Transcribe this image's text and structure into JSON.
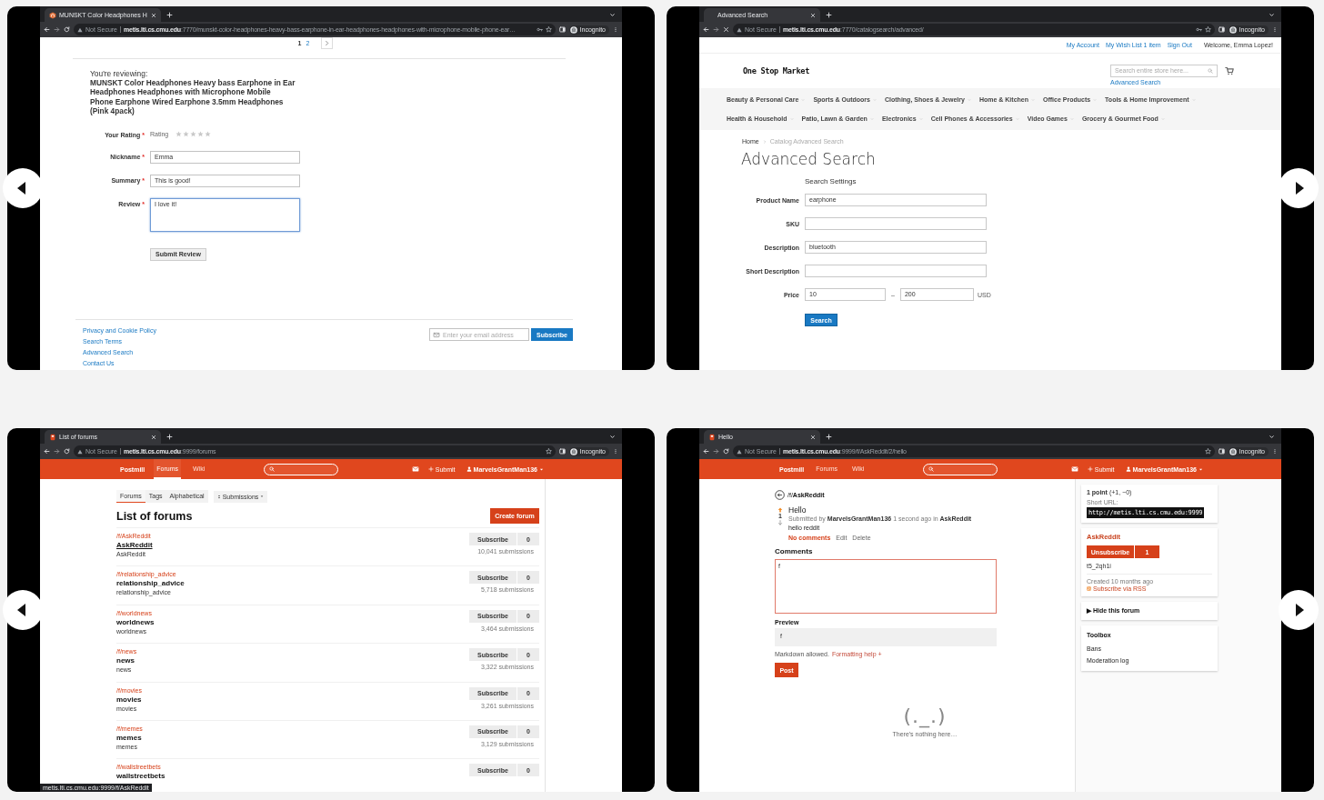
{
  "panels": [
    {
      "carousel_arrow": {
        "kind": "left"
      },
      "browser": {
        "tab_title": "MUNSKT Color Headphones H",
        "favicon": {
          "kind": "store"
        },
        "url_host": "metis.lti.cs.cmu.edu",
        "url_path": ":7770/munskt-color-headphones-heavy-bass-earphone-in-ear-headphones-headphones-with-microphone-mobile-phone-ear…",
        "security": "Not Secure",
        "profile": "Incognito",
        "loading": false,
        "password_key": true
      },
      "page": {
        "kind": "review",
        "pager": [
          {
            "label": "1",
            "selected": true
          },
          {
            "label": "2",
            "selected": false
          }
        ],
        "reviewing_label": "You're reviewing:",
        "product": "MUNSKT Color Headphones Heavy bass Earphone in Ear Headphones Headphones with Microphone Mobile Phone Earphone Wired Earphone 3.5mm Headphones (Pink 4pack)",
        "rating": {
          "label": "Your Rating",
          "required_mark": "*",
          "text": "Rating",
          "stars": 0
        },
        "fields": [
          {
            "kind": "input",
            "label": "Nickname",
            "required_mark": "*",
            "value": "Emma",
            "focused": false
          },
          {
            "kind": "input",
            "label": "Summary",
            "required_mark": "*",
            "value": "This is good!",
            "focused": false
          },
          {
            "kind": "textarea",
            "label": "Review",
            "required_mark": "*",
            "value": "I love it!",
            "focused": true
          }
        ],
        "submit": "Submit Review",
        "footer_links": [
          "Privacy and Cookie Policy",
          "Search Terms",
          "Advanced Search",
          "Contact Us"
        ],
        "newsletter": {
          "placeholder": "Enter your email address",
          "button": "Subscribe"
        }
      }
    },
    {
      "carousel_arrow": {
        "kind": "right"
      },
      "browser": {
        "tab_title": "Advanced Search",
        "favicon": {
          "kind": "blank"
        },
        "url_host": "metis.lti.cs.cmu.edu",
        "url_path": ":7770/catalogsearch/advanced/",
        "security": "Not Secure",
        "profile": "Incognito",
        "loading": true,
        "password_key": true
      },
      "page": {
        "kind": "advanced_search",
        "header_links": [
          "My Account",
          "My Wish List 1 item",
          "Sign Out"
        ],
        "welcome": "Welcome, Emma Lopez!",
        "logo": "One Stop Market",
        "search_placeholder": "Search entire store here...",
        "advanced_link": "Advanced Search",
        "category_rows": [
          {
            "items": [
              "Beauty & Personal Care",
              "Sports & Outdoors",
              "Clothing, Shoes & Jewelry",
              "Home & Kitchen",
              "Office Products",
              "Tools & Home Improvement"
            ]
          },
          {
            "items": [
              "Health & Household",
              "Patio, Lawn & Garden",
              "Electronics",
              "Cell Phones & Accessories",
              "Video Games",
              "Grocery & Gourmet Food"
            ]
          }
        ],
        "breadcrumbs": [
          "Home",
          "Catalog Advanced Search"
        ],
        "title": "Advanced Search",
        "section": "Search Settings",
        "fields": [
          {
            "label": "Product Name",
            "value": "earphone"
          },
          {
            "label": "SKU"
          },
          {
            "label": "Description",
            "value": "bluetooth"
          },
          {
            "label": "Short Description"
          }
        ],
        "price": {
          "label": "Price",
          "from": "10",
          "separator": "–",
          "to": "200",
          "currency": "USD"
        },
        "button": "Search"
      }
    },
    {
      "carousel_arrow": {
        "kind": "left"
      },
      "browser": {
        "tab_title": "List of forums",
        "favicon": {
          "kind": "postmill"
        },
        "url_host": "metis.lti.cs.cmu.edu",
        "url_path": ":9999/forums",
        "security": "Not Secure",
        "profile": "Incognito",
        "loading": false,
        "password_key": false
      },
      "page": {
        "kind": "forum_list",
        "nav": {
          "brand": "Postmill",
          "links": [
            {
              "label": "Forums",
              "selected": true
            },
            {
              "label": "Wiki",
              "selected": false
            }
          ],
          "submit": "Submit",
          "user": "MarvelsGrantMan136"
        },
        "subtabs": [
          {
            "label": "Forums",
            "selected": true
          },
          {
            "label": "Tags",
            "selected": false
          },
          {
            "label": "Alphabetical",
            "selected": false
          }
        ],
        "sort": "Submissions",
        "title": "List of forums",
        "create": "Create forum",
        "forums": [
          {
            "path": "/f/AskReddit",
            "name": "AskReddit",
            "description": "AskReddit",
            "subscribe": "Subscribe",
            "count": "0",
            "submissions": "10,041 submissions",
            "hovered": true
          },
          {
            "path": "/f/relationship_advice",
            "name": "relationship_advice",
            "description": "relationship_advice",
            "subscribe": "Subscribe",
            "count": "0",
            "submissions": "5,718 submissions",
            "hovered": false
          },
          {
            "path": "/f/worldnews",
            "name": "worldnews",
            "description": "worldnews",
            "subscribe": "Subscribe",
            "count": "0",
            "submissions": "3,464 submissions",
            "hovered": false
          },
          {
            "path": "/f/news",
            "name": "news",
            "description": "news",
            "subscribe": "Subscribe",
            "count": "0",
            "submissions": "3,322 submissions",
            "hovered": false
          },
          {
            "path": "/f/movies",
            "name": "movies",
            "description": "movies",
            "subscribe": "Subscribe",
            "count": "0",
            "submissions": "3,261 submissions",
            "hovered": false
          },
          {
            "path": "/f/memes",
            "name": "memes",
            "description": "memes",
            "subscribe": "Subscribe",
            "count": "0",
            "submissions": "3,129 submissions",
            "hovered": false
          },
          {
            "path": "/f/wallstreetbets",
            "name": "wallstreetbets",
            "subscribe": "Subscribe",
            "count": "0",
            "hovered": false
          }
        ],
        "status_url": "metis.lti.cs.cmu.edu:9999/f/AskReddit"
      }
    },
    {
      "carousel_arrow": {
        "kind": "right"
      },
      "browser": {
        "tab_title": "Hello",
        "favicon": {
          "kind": "postmill"
        },
        "url_host": "metis.lti.cs.cmu.edu",
        "url_path": ":9999/f/AskReddit/2/hello",
        "security": "Not Secure",
        "profile": "Incognito",
        "loading": false,
        "password_key": false
      },
      "page": {
        "kind": "post",
        "nav": {
          "brand": "Postmill",
          "links": [
            {
              "label": "Forums",
              "selected": false
            },
            {
              "label": "Wiki",
              "selected": false
            }
          ],
          "submit": "Submit",
          "user": "MarvelsGrantMan136"
        },
        "forum_path": "/f/**AskReddit**",
        "post": {
          "upvoted": true,
          "score": "1",
          "title": "Hello",
          "meta": "Submitted by **MarvelsGrantMan136** 1 second ago in **AskReddit**",
          "body": "hello reddit",
          "actions": [
            "No comments",
            "Edit",
            "Delete"
          ]
        },
        "comments_heading": "Comments",
        "comment": {
          "value": "f",
          "focused": true
        },
        "preview_label": "Preview",
        "preview_text": "f",
        "markdown_note": "Markdown allowed.",
        "formatting_link": "Formatting help +",
        "post_button": "Post",
        "empty_face": "(._.)",
        "empty_text": "There's nothing here…",
        "sidebar": {
          "points": "**1 point** (+1, −0)",
          "short_url_label": "Short URL:",
          "short_url": "http://metis.lti.cs.cmu.edu:9999",
          "forum": "AskReddit",
          "unsubscribe": "Unsubscribe",
          "subscribers": "1",
          "forum_id": "t5_2qh1i",
          "created": "Created 10 months ago",
          "rss": "Subscribe via RSS",
          "hide_marker": "▶",
          "hide_label": "Hide this forum",
          "toolbox": "Toolbox",
          "tools": [
            "Bans",
            "Moderation log"
          ]
        }
      }
    }
  ]
}
